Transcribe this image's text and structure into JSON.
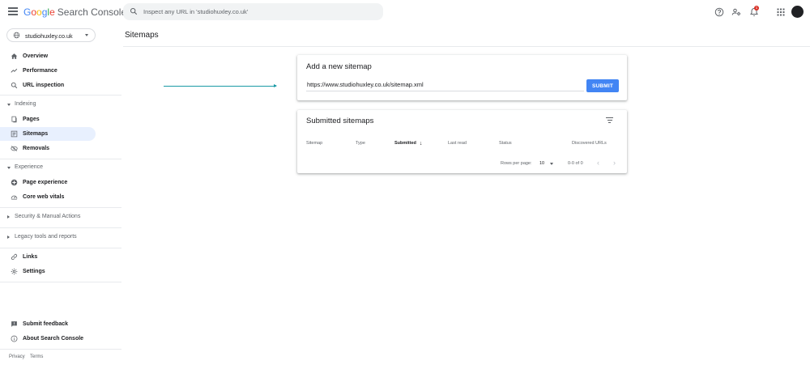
{
  "header": {
    "logo_google": [
      "G",
      "o",
      "o",
      "g",
      "l",
      "e"
    ],
    "logo_product": "Search Console",
    "search_placeholder": "Inspect any URL in 'studiohuxley.co.uk'",
    "notification_count": "1",
    "icons": [
      "menu-icon",
      "search-icon",
      "help-icon",
      "manage-users-icon",
      "bell-icon",
      "apps-grid-icon"
    ]
  },
  "property": {
    "name": "studiohuxley.co.uk"
  },
  "sidebar": {
    "top_items": [
      {
        "label": "Overview",
        "icon": "home-icon"
      },
      {
        "label": "Performance",
        "icon": "trending-icon"
      },
      {
        "label": "URL inspection",
        "icon": "search-icon"
      }
    ],
    "indexing": {
      "title": "Indexing",
      "items": [
        {
          "label": "Pages",
          "icon": "pages-icon"
        },
        {
          "label": "Sitemaps",
          "icon": "sitemaps-icon",
          "active": true
        },
        {
          "label": "Removals",
          "icon": "removals-icon"
        }
      ]
    },
    "experience": {
      "title": "Experience",
      "items": [
        {
          "label": "Page experience",
          "icon": "page-experience-icon"
        },
        {
          "label": "Core web vitals",
          "icon": "gauge-icon"
        }
      ]
    },
    "security_title": "Security & Manual Actions",
    "legacy_title": "Legacy tools and reports",
    "bottom_items": [
      {
        "label": "Links",
        "icon": "link-icon"
      },
      {
        "label": "Settings",
        "icon": "gear-icon"
      }
    ],
    "feedback_items": [
      {
        "label": "Submit feedback",
        "icon": "feedback-icon"
      },
      {
        "label": "About Search Console",
        "icon": "info-icon"
      }
    ],
    "footer": {
      "privacy": "Privacy",
      "terms": "Terms"
    }
  },
  "main": {
    "page_title": "Sitemaps",
    "add_card": {
      "title": "Add a new sitemap",
      "url_value": "https://www.studiohuxley.co.uk/sitemap.xml",
      "submit_label": "SUBMIT"
    },
    "submitted_card": {
      "title": "Submitted sitemaps",
      "columns": [
        "Sitemap",
        "Type",
        "Submitted",
        "Last read",
        "Status",
        "Discovered URLs"
      ],
      "sorted_column": "Submitted",
      "rows_per_page_label": "Rows per page:",
      "rows_per_page_value": "10",
      "range_label": "0-0 of 0"
    }
  },
  "colors": {
    "brand_blue": "#4285f4",
    "active_nav_bg": "#e8f0fe",
    "arrow_annotation": "#1a9aa6",
    "notification_red": "#d93025"
  }
}
